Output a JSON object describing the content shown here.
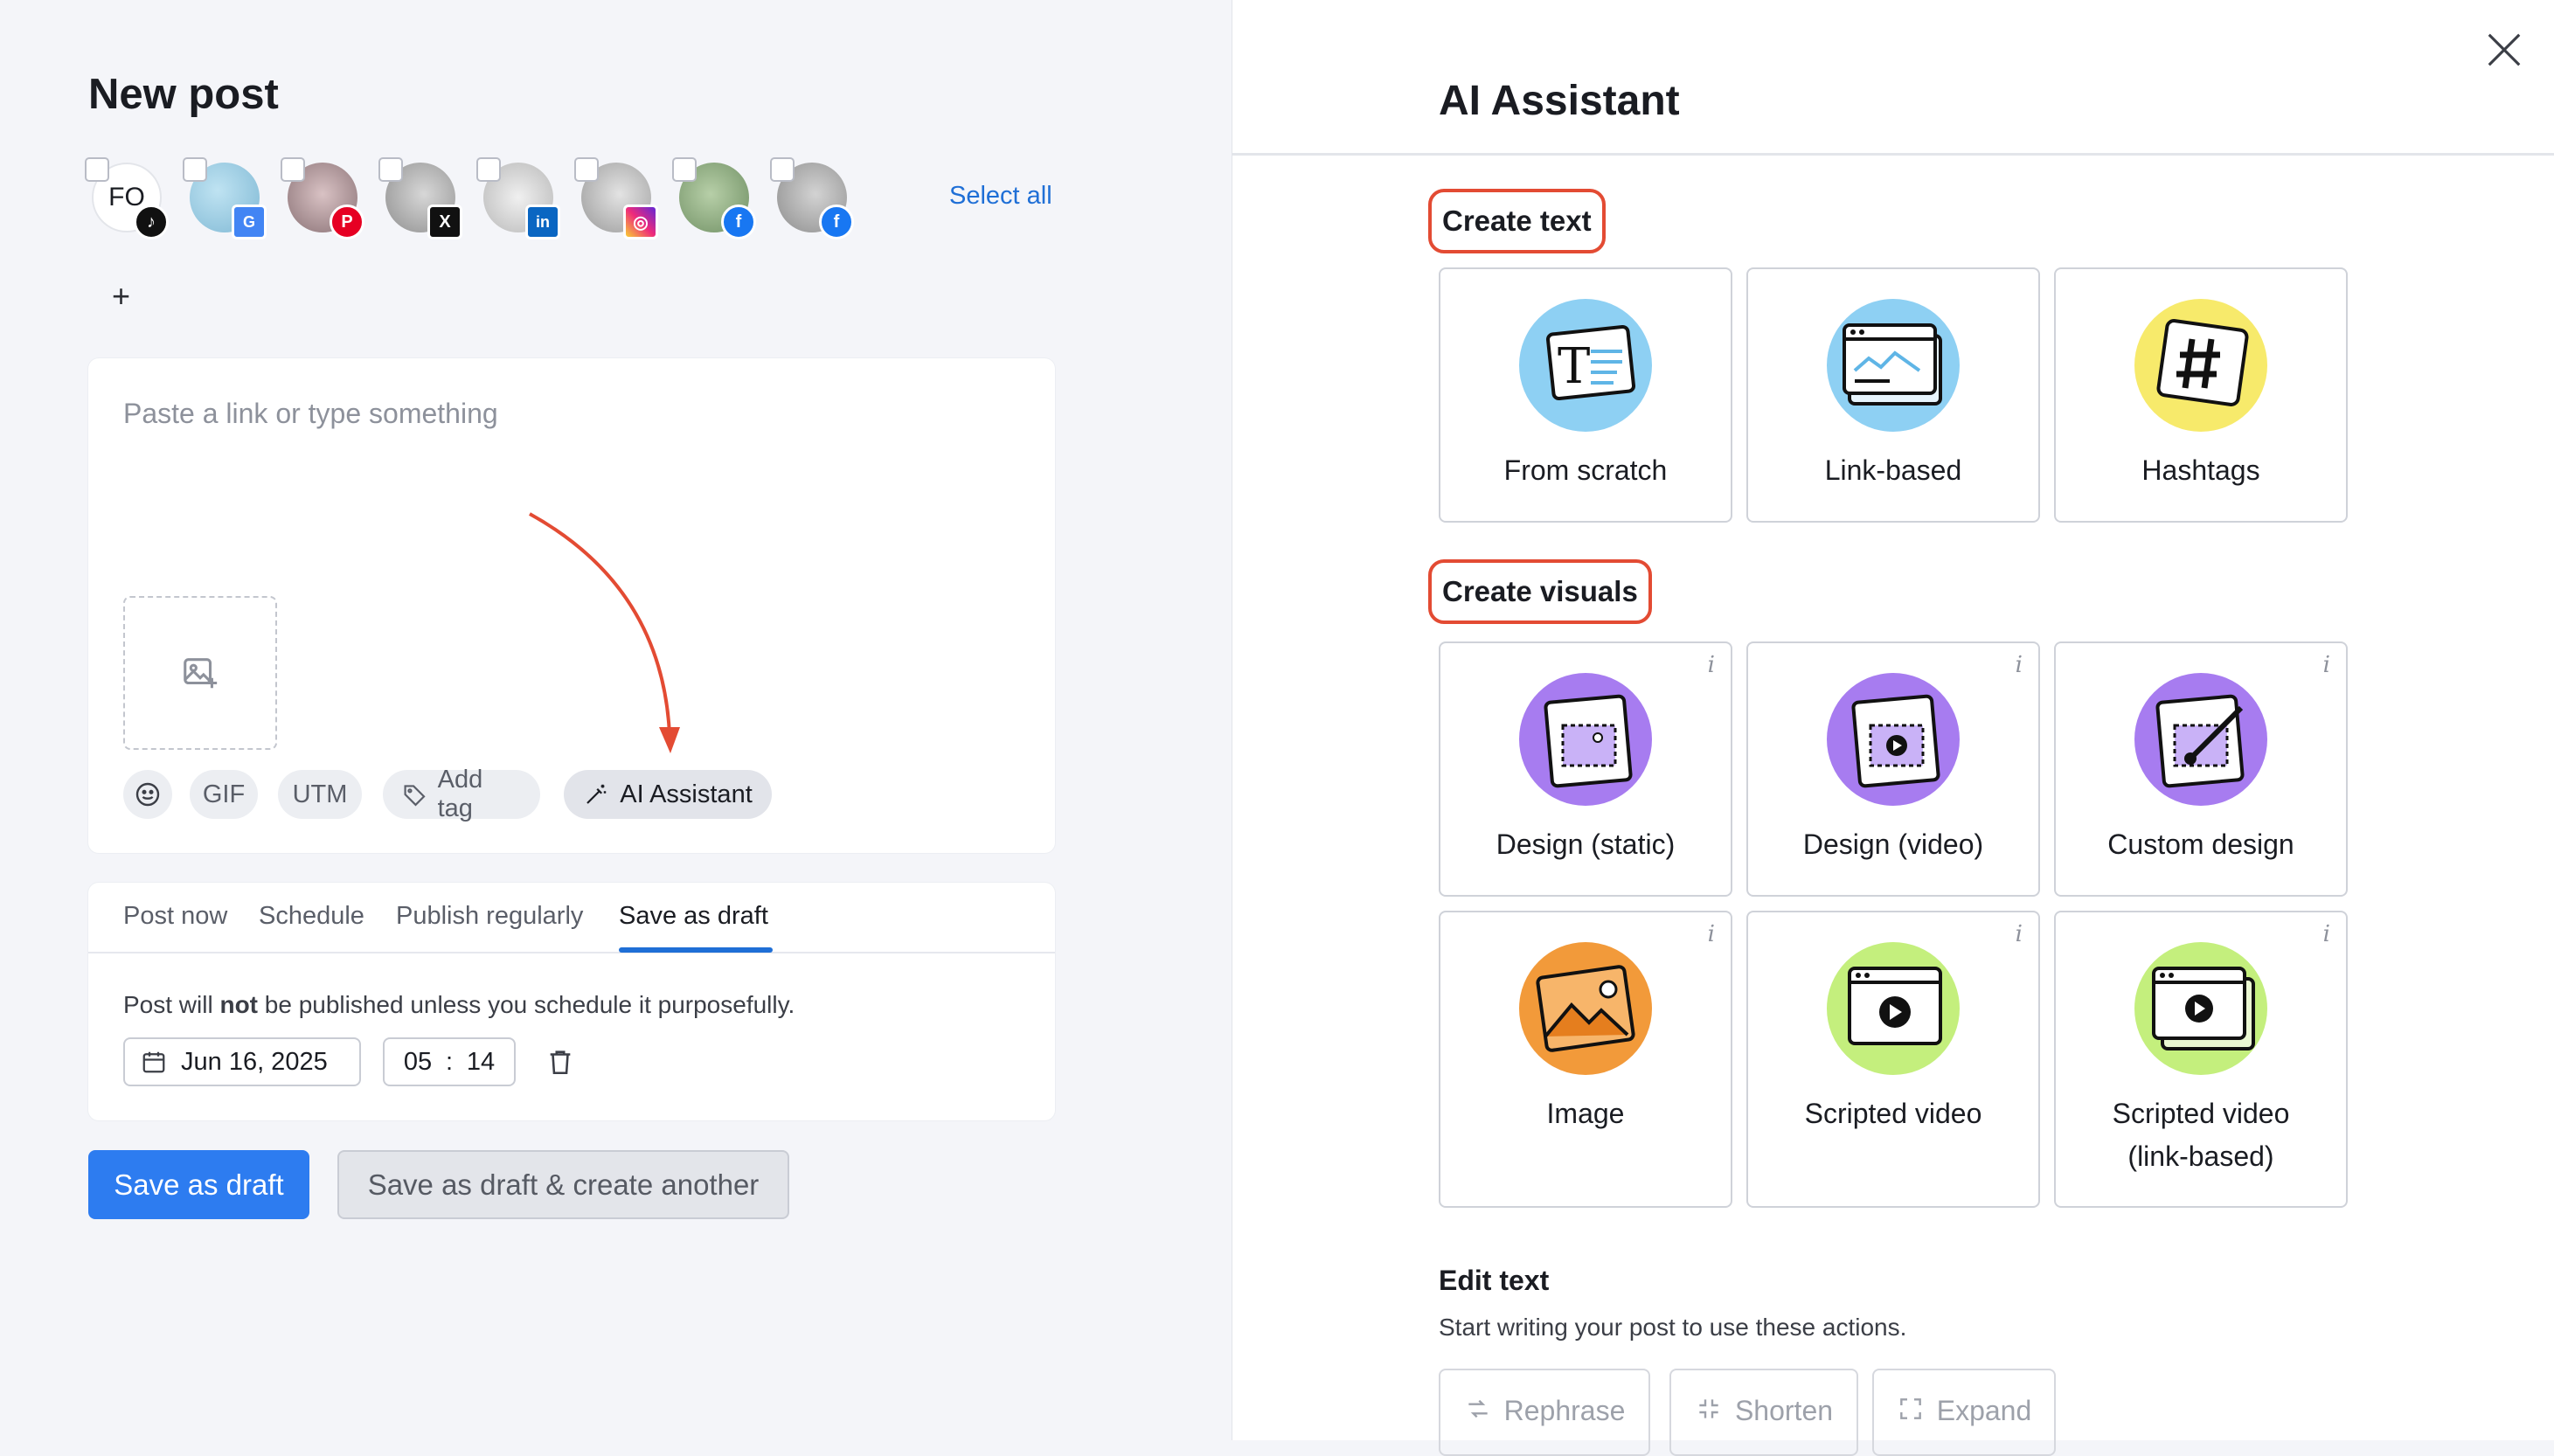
{
  "composer": {
    "title": "New post",
    "select_all": "Select all",
    "add_account": "+",
    "placeholder": "Paste a link or type something",
    "tools": {
      "gif": "GIF",
      "utm": "UTM",
      "add_tag": "Add tag",
      "ai": "AI Assistant"
    }
  },
  "accounts": [
    {
      "initials": "FO",
      "network": "tiktok",
      "network_color": "#111111"
    },
    {
      "network": "google-business",
      "network_color": "#4285f4"
    },
    {
      "network": "pinterest",
      "network_color": "#e60023"
    },
    {
      "network": "x",
      "network_color": "#111111"
    },
    {
      "network": "linkedin",
      "network_color": "#0a66c2"
    },
    {
      "network": "instagram",
      "network_color": "#d6249f"
    },
    {
      "network": "facebook",
      "network_color": "#1877f2"
    },
    {
      "network": "facebook",
      "network_color": "#1877f2"
    }
  ],
  "publish": {
    "tabs": [
      "Post now",
      "Schedule",
      "Publish regularly",
      "Save as draft"
    ],
    "active_tab": "Save as draft",
    "note_before": "Post will ",
    "note_bold": "not",
    "note_after": " be published unless you schedule it purposefully.",
    "date": "Jun 16, 2025",
    "hour": "05",
    "sep": ":",
    "minute": "14"
  },
  "actions": {
    "save": "Save as draft",
    "save_another": "Save as draft & create another"
  },
  "ai_panel": {
    "title": "AI Assistant",
    "create_text_heading": "Create text",
    "create_text": [
      "From scratch",
      "Link-based",
      "Hashtags"
    ],
    "create_visuals_heading": "Create visuals",
    "create_visuals": [
      "Design (static)",
      "Design (video)",
      "Custom design",
      "Image",
      "Scripted video",
      "Scripted video (link-based)"
    ],
    "info_glyph": "i",
    "edit_heading": "Edit text",
    "edit_desc": "Start writing your post to use these actions.",
    "edit_actions": [
      "Rephrase",
      "Shorten",
      "Expand"
    ]
  },
  "colors": {
    "accent": "#2d7cf0",
    "link": "#1f6fd6",
    "highlight": "#e34b33",
    "arrow": "#e34b33"
  }
}
